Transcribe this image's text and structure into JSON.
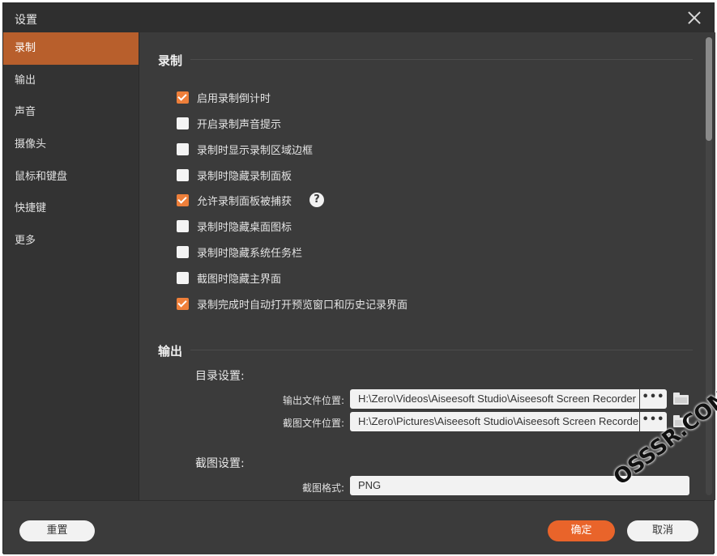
{
  "window": {
    "title": "设置"
  },
  "sidebar": {
    "items": [
      {
        "label": "录制",
        "active": true
      },
      {
        "label": "输出",
        "active": false
      },
      {
        "label": "声音",
        "active": false
      },
      {
        "label": "摄像头",
        "active": false
      },
      {
        "label": "鼠标和键盘",
        "active": false
      },
      {
        "label": "快捷键",
        "active": false
      },
      {
        "label": "更多",
        "active": false
      }
    ]
  },
  "recording": {
    "title": "录制",
    "options": [
      {
        "label": "启用录制倒计时",
        "checked": true
      },
      {
        "label": "开启录制声音提示",
        "checked": false
      },
      {
        "label": "录制时显示录制区域边框",
        "checked": false
      },
      {
        "label": "录制时隐藏录制面板",
        "checked": false
      },
      {
        "label": "允许录制面板被捕获",
        "checked": true,
        "help": "?"
      },
      {
        "label": "录制时隐藏桌面图标",
        "checked": false
      },
      {
        "label": "录制时隐藏系统任务栏",
        "checked": false
      },
      {
        "label": "截图时隐藏主界面",
        "checked": false
      },
      {
        "label": "录制完成时自动打开预览窗口和历史记录界面",
        "checked": true
      }
    ]
  },
  "output": {
    "title": "输出",
    "directory_heading": "目录设置:",
    "output_folder_label": "输出文件位置:",
    "output_folder_value": "H:\\Zero\\Videos\\Aiseesoft Studio\\Aiseesoft Screen Recorder",
    "screenshot_folder_label": "截图文件位置:",
    "screenshot_folder_value": "H:\\Zero\\Pictures\\Aiseesoft Studio\\Aiseesoft Screen Recorder",
    "browse_label": "•••",
    "screenshot_heading": "截图设置:",
    "format_label": "截图格式:",
    "format_value": "PNG"
  },
  "footer": {
    "reset_label": "重置",
    "ok_label": "确定",
    "cancel_label": "取消"
  },
  "watermark": "OSSSR.COM",
  "colors": {
    "accent": "#e9642a",
    "active_nav": "#b85f2c",
    "checkbox_checked": "#ee7f3a",
    "panel": "#3b3b3b",
    "sidebar": "#333333"
  }
}
